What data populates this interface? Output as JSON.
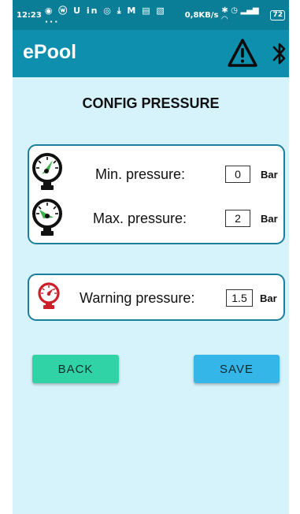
{
  "status_bar": {
    "time": "12:23",
    "notification_icons": "◉ ⓦ U in ◎ ⤓ M ▤ ▧ ···",
    "network_speed": "0,8KB/s",
    "battery": "72"
  },
  "app_bar": {
    "title": "ePool",
    "warning_icon": "warning-triangle-icon",
    "bluetooth_icon": "bluetooth-icon"
  },
  "page": {
    "title": "CONFIG PRESSURE"
  },
  "pressure_range": {
    "min": {
      "label": "Min. pressure:",
      "value": "0",
      "unit": "Bar"
    },
    "max": {
      "label": "Max. pressure:",
      "value": "2",
      "unit": "Bar"
    }
  },
  "warning_pressure": {
    "label": "Warning pressure:",
    "value": "1.5",
    "unit": "Bar"
  },
  "buttons": {
    "back": "BACK",
    "save": "SAVE"
  },
  "colors": {
    "app_bar": "#0e8fae",
    "status_bar": "#0a7d97",
    "background": "#d6f3fb",
    "card_border": "#1a7f9d",
    "back_button": "#30d3a5",
    "save_button": "#35b6e9",
    "gauge_needle": "#3cb54a",
    "warning_gauge": "#cc1f2b"
  }
}
